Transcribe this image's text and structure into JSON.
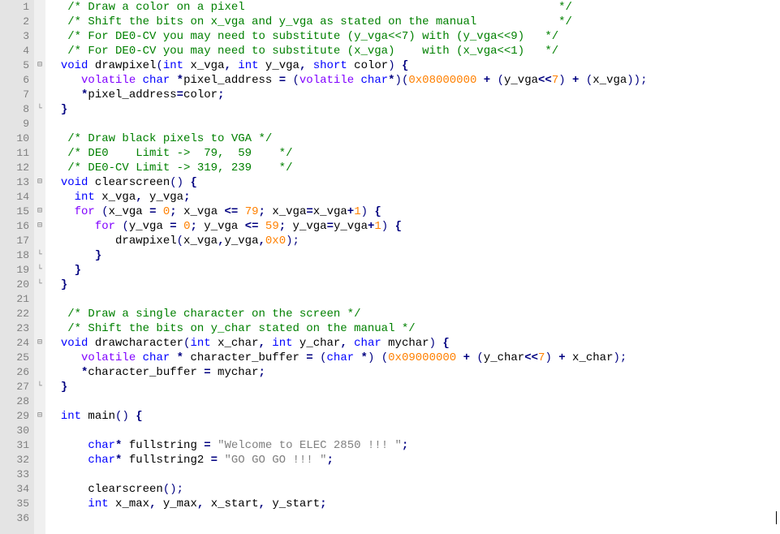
{
  "gutter": {
    "lines": [
      "1",
      "2",
      "3",
      "4",
      "5",
      "6",
      "7",
      "8",
      "9",
      "10",
      "11",
      "12",
      "13",
      "14",
      "15",
      "16",
      "17",
      "18",
      "19",
      "20",
      "21",
      "22",
      "23",
      "24",
      "25",
      "26",
      "27",
      "28",
      "29",
      "30",
      "31",
      "32",
      "33",
      "34",
      "35",
      "36"
    ]
  },
  "fold": {
    "markers": {
      "5": "⊟",
      "8": "└",
      "13": "⊟",
      "15": "⊟",
      "16": "⊟",
      "18": "└",
      "19": "└",
      "20": "└",
      "24": "⊟",
      "27": "└",
      "29": "⊟"
    }
  },
  "code": {
    "lines": [
      [
        [
          "   ",
          ""
        ],
        [
          "/* Draw a color on a pixel                                              */",
          "c-comment"
        ]
      ],
      [
        [
          "   ",
          ""
        ],
        [
          "/* Shift the bits on x_vga and y_vga as stated on the manual            */",
          "c-comment"
        ]
      ],
      [
        [
          "   ",
          ""
        ],
        [
          "/* For DE0-CV you may need to substitute (y_vga<<7) with (y_vga<<9)   */",
          "c-comment"
        ]
      ],
      [
        [
          "   ",
          ""
        ],
        [
          "/* For DE0-CV you may need to substitute (x_vga)    with (x_vga<<1)   */",
          "c-comment"
        ]
      ],
      [
        [
          "  ",
          ""
        ],
        [
          "void",
          "c-keyword"
        ],
        [
          " drawpixel",
          ""
        ],
        [
          "(",
          "c-paren"
        ],
        [
          "int",
          "c-keyword"
        ],
        [
          " x_vga",
          ""
        ],
        [
          ",",
          "c-op"
        ],
        [
          " ",
          ""
        ],
        [
          "int",
          "c-keyword"
        ],
        [
          " y_vga",
          ""
        ],
        [
          ",",
          "c-op"
        ],
        [
          " ",
          ""
        ],
        [
          "short",
          "c-keyword"
        ],
        [
          " color",
          ""
        ],
        [
          ")",
          "c-paren"
        ],
        [
          " ",
          ""
        ],
        [
          "{",
          "c-op"
        ]
      ],
      [
        [
          "     ",
          ""
        ],
        [
          "volatile",
          "c-type"
        ],
        [
          " ",
          ""
        ],
        [
          "char",
          "c-keyword"
        ],
        [
          " ",
          ""
        ],
        [
          "*",
          "c-op"
        ],
        [
          "pixel_address ",
          ""
        ],
        [
          "=",
          "c-op"
        ],
        [
          " ",
          ""
        ],
        [
          "(",
          "c-paren"
        ],
        [
          "volatile",
          "c-type"
        ],
        [
          " ",
          ""
        ],
        [
          "char",
          "c-keyword"
        ],
        [
          "*",
          "c-op"
        ],
        [
          ")(",
          "c-paren"
        ],
        [
          "0x08000000",
          "c-number"
        ],
        [
          " ",
          ""
        ],
        [
          "+",
          "c-op"
        ],
        [
          " ",
          ""
        ],
        [
          "(",
          "c-paren"
        ],
        [
          "y_vga",
          ""
        ],
        [
          "<<",
          "c-op"
        ],
        [
          "7",
          "c-number"
        ],
        [
          ")",
          "c-paren"
        ],
        [
          " ",
          ""
        ],
        [
          "+",
          "c-op"
        ],
        [
          " ",
          ""
        ],
        [
          "(",
          "c-paren"
        ],
        [
          "x_vga",
          ""
        ],
        [
          "));",
          "c-paren"
        ]
      ],
      [
        [
          "     ",
          ""
        ],
        [
          "*",
          "c-op"
        ],
        [
          "pixel_address",
          ""
        ],
        [
          "=",
          "c-op"
        ],
        [
          "color",
          ""
        ],
        [
          ";",
          "c-op"
        ]
      ],
      [
        [
          "  ",
          ""
        ],
        [
          "}",
          "c-op"
        ]
      ],
      [
        [
          "",
          ""
        ]
      ],
      [
        [
          "   ",
          ""
        ],
        [
          "/* Draw black pixels to VGA */",
          "c-comment"
        ]
      ],
      [
        [
          "   ",
          ""
        ],
        [
          "/* DE0    Limit ->  79,  59    */",
          "c-comment"
        ]
      ],
      [
        [
          "   ",
          ""
        ],
        [
          "/* DE0-CV Limit -> 319, 239    */",
          "c-comment"
        ]
      ],
      [
        [
          "  ",
          ""
        ],
        [
          "void",
          "c-keyword"
        ],
        [
          " clearscreen",
          ""
        ],
        [
          "()",
          "c-paren"
        ],
        [
          " ",
          ""
        ],
        [
          "{",
          "c-op"
        ]
      ],
      [
        [
          "    ",
          ""
        ],
        [
          "int",
          "c-keyword"
        ],
        [
          " x_vga",
          ""
        ],
        [
          ",",
          "c-op"
        ],
        [
          " y_vga",
          ""
        ],
        [
          ";",
          "c-op"
        ]
      ],
      [
        [
          "    ",
          ""
        ],
        [
          "for",
          "c-type"
        ],
        [
          " ",
          ""
        ],
        [
          "(",
          "c-paren"
        ],
        [
          "x_vga ",
          ""
        ],
        [
          "=",
          "c-op"
        ],
        [
          " ",
          ""
        ],
        [
          "0",
          "c-number"
        ],
        [
          ";",
          "c-op"
        ],
        [
          " x_vga ",
          ""
        ],
        [
          "<=",
          "c-op"
        ],
        [
          " ",
          ""
        ],
        [
          "79",
          "c-number"
        ],
        [
          ";",
          "c-op"
        ],
        [
          " x_vga",
          ""
        ],
        [
          "=",
          "c-op"
        ],
        [
          "x_vga",
          ""
        ],
        [
          "+",
          "c-op"
        ],
        [
          "1",
          "c-number"
        ],
        [
          ")",
          "c-paren"
        ],
        [
          " ",
          ""
        ],
        [
          "{",
          "c-op"
        ]
      ],
      [
        [
          "       ",
          ""
        ],
        [
          "for",
          "c-type"
        ],
        [
          " ",
          ""
        ],
        [
          "(",
          "c-paren"
        ],
        [
          "y_vga ",
          ""
        ],
        [
          "=",
          "c-op"
        ],
        [
          " ",
          ""
        ],
        [
          "0",
          "c-number"
        ],
        [
          ";",
          "c-op"
        ],
        [
          " y_vga ",
          ""
        ],
        [
          "<=",
          "c-op"
        ],
        [
          " ",
          ""
        ],
        [
          "59",
          "c-number"
        ],
        [
          ";",
          "c-op"
        ],
        [
          " y_vga",
          ""
        ],
        [
          "=",
          "c-op"
        ],
        [
          "y_vga",
          ""
        ],
        [
          "+",
          "c-op"
        ],
        [
          "1",
          "c-number"
        ],
        [
          ")",
          "c-paren"
        ],
        [
          " ",
          ""
        ],
        [
          "{",
          "c-op"
        ]
      ],
      [
        [
          "          drawpixel",
          ""
        ],
        [
          "(",
          "c-paren"
        ],
        [
          "x_vga",
          ""
        ],
        [
          ",",
          "c-op"
        ],
        [
          "y_vga",
          ""
        ],
        [
          ",",
          "c-op"
        ],
        [
          "0x0",
          "c-number"
        ],
        [
          ");",
          "c-paren"
        ]
      ],
      [
        [
          "       ",
          ""
        ],
        [
          "}",
          "c-op"
        ]
      ],
      [
        [
          "    ",
          ""
        ],
        [
          "}",
          "c-op"
        ]
      ],
      [
        [
          "  ",
          ""
        ],
        [
          "}",
          "c-op"
        ]
      ],
      [
        [
          "",
          ""
        ]
      ],
      [
        [
          "   ",
          ""
        ],
        [
          "/* Draw a single character on the screen */",
          "c-comment"
        ]
      ],
      [
        [
          "   ",
          ""
        ],
        [
          "/* Shift the bits on y_char stated on the manual */",
          "c-comment"
        ]
      ],
      [
        [
          "  ",
          ""
        ],
        [
          "void",
          "c-keyword"
        ],
        [
          " drawcharacter",
          ""
        ],
        [
          "(",
          "c-paren"
        ],
        [
          "int",
          "c-keyword"
        ],
        [
          " x_char",
          ""
        ],
        [
          ",",
          "c-op"
        ],
        [
          " ",
          ""
        ],
        [
          "int",
          "c-keyword"
        ],
        [
          " y_char",
          ""
        ],
        [
          ",",
          "c-op"
        ],
        [
          " ",
          ""
        ],
        [
          "char",
          "c-keyword"
        ],
        [
          " mychar",
          ""
        ],
        [
          ")",
          "c-paren"
        ],
        [
          " ",
          ""
        ],
        [
          "{",
          "c-op"
        ]
      ],
      [
        [
          "     ",
          ""
        ],
        [
          "volatile",
          "c-type"
        ],
        [
          " ",
          ""
        ],
        [
          "char",
          "c-keyword"
        ],
        [
          " ",
          ""
        ],
        [
          "*",
          "c-op"
        ],
        [
          " character_buffer ",
          ""
        ],
        [
          "=",
          "c-op"
        ],
        [
          " ",
          ""
        ],
        [
          "(",
          "c-paren"
        ],
        [
          "char",
          "c-keyword"
        ],
        [
          " ",
          ""
        ],
        [
          "*",
          "c-op"
        ],
        [
          ")",
          "c-paren"
        ],
        [
          " ",
          ""
        ],
        [
          "(",
          "c-paren"
        ],
        [
          "0x09000000",
          "c-number"
        ],
        [
          " ",
          ""
        ],
        [
          "+",
          "c-op"
        ],
        [
          " ",
          ""
        ],
        [
          "(",
          "c-paren"
        ],
        [
          "y_char",
          ""
        ],
        [
          "<<",
          "c-op"
        ],
        [
          "7",
          "c-number"
        ],
        [
          ")",
          "c-paren"
        ],
        [
          " ",
          ""
        ],
        [
          "+",
          "c-op"
        ],
        [
          " x_char",
          ""
        ],
        [
          ");",
          "c-paren"
        ]
      ],
      [
        [
          "     ",
          ""
        ],
        [
          "*",
          "c-op"
        ],
        [
          "character_buffer ",
          ""
        ],
        [
          "=",
          "c-op"
        ],
        [
          " mychar",
          ""
        ],
        [
          ";",
          "c-op"
        ]
      ],
      [
        [
          "  ",
          ""
        ],
        [
          "}",
          "c-op"
        ]
      ],
      [
        [
          "",
          ""
        ]
      ],
      [
        [
          "  ",
          ""
        ],
        [
          "int",
          "c-keyword"
        ],
        [
          " main",
          ""
        ],
        [
          "()",
          "c-paren"
        ],
        [
          " ",
          ""
        ],
        [
          "{",
          "c-op"
        ]
      ],
      [
        [
          "",
          ""
        ]
      ],
      [
        [
          "      ",
          ""
        ],
        [
          "char",
          "c-keyword"
        ],
        [
          "*",
          "c-op"
        ],
        [
          " fullstring ",
          ""
        ],
        [
          "=",
          "c-op"
        ],
        [
          " ",
          ""
        ],
        [
          "\"Welcome to ELEC 2850 !!! \"",
          "c-string"
        ],
        [
          ";",
          "c-op"
        ]
      ],
      [
        [
          "      ",
          ""
        ],
        [
          "char",
          "c-keyword"
        ],
        [
          "*",
          "c-op"
        ],
        [
          " fullstring2 ",
          ""
        ],
        [
          "=",
          "c-op"
        ],
        [
          " ",
          ""
        ],
        [
          "\"GO GO GO !!! \"",
          "c-string"
        ],
        [
          ";",
          "c-op"
        ]
      ],
      [
        [
          "",
          ""
        ]
      ],
      [
        [
          "      clearscreen",
          ""
        ],
        [
          "();",
          "c-paren"
        ]
      ],
      [
        [
          "      ",
          ""
        ],
        [
          "int",
          "c-keyword"
        ],
        [
          " x_max",
          ""
        ],
        [
          ",",
          "c-op"
        ],
        [
          " y_max",
          ""
        ],
        [
          ",",
          "c-op"
        ],
        [
          " x_start",
          ""
        ],
        [
          ",",
          "c-op"
        ],
        [
          " y_start",
          ""
        ],
        [
          ";",
          "c-op"
        ]
      ],
      [
        [
          "",
          ""
        ]
      ]
    ]
  }
}
